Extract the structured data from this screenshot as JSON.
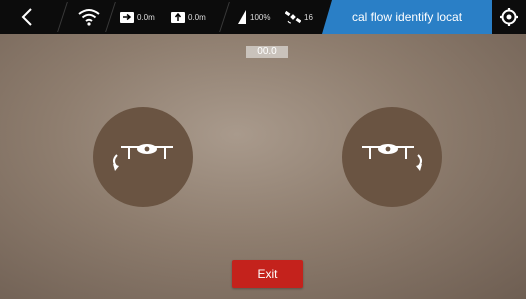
{
  "topbar": {
    "back_icon": "chevron-left-icon",
    "wifi_icon": "wifi-icon",
    "distance": "0.0m",
    "altitude": "0.0m",
    "battery": "100%",
    "satellites": "16",
    "mode_text": "cal flow identify locat",
    "settings_icon": "settings-icon"
  },
  "readout": "00.0",
  "controls": {
    "left_rotate_icon": "rotate-left-drone-icon",
    "right_rotate_icon": "rotate-right-drone-icon"
  },
  "exit_label": "Exit",
  "colors": {
    "topbar_bg": "#0c0c0c",
    "mode_pill": "#2a7fc6",
    "exit_button": "#c4221c",
    "control_circle": "#6a5442"
  }
}
